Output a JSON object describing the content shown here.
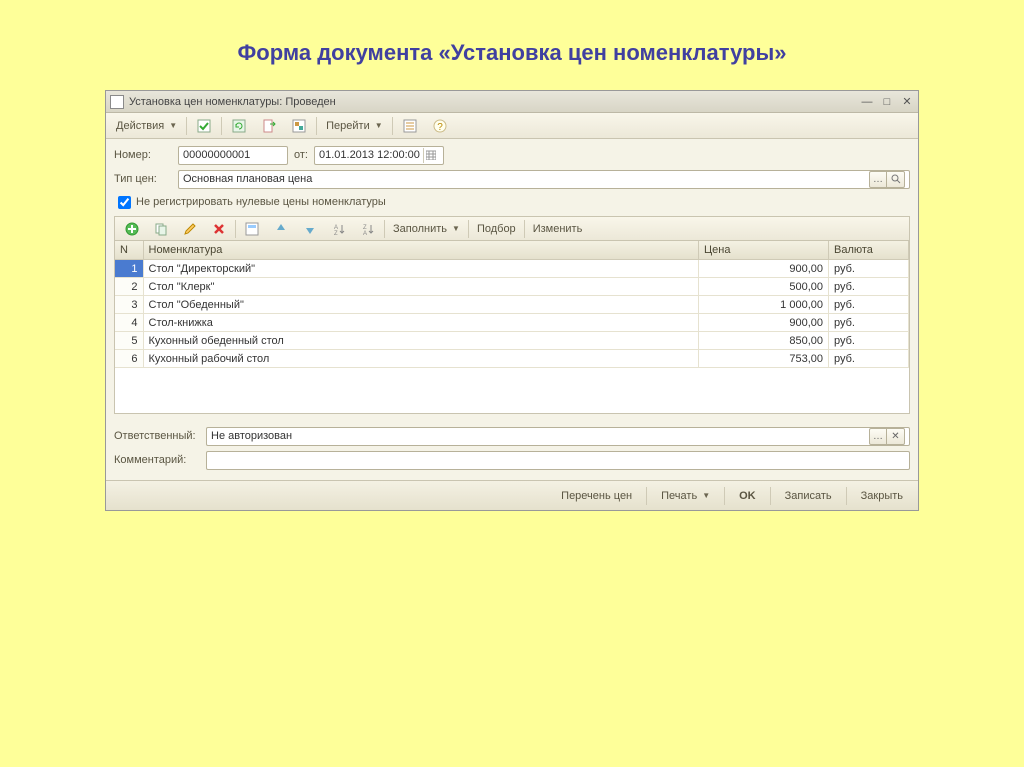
{
  "slide_title": "Форма документа «Установка цен номенклатуры»",
  "window": {
    "title": "Установка цен номенклатуры: Проведен"
  },
  "toolbar": {
    "actions": "Действия",
    "goto": "Перейти"
  },
  "fields": {
    "number_label": "Номер:",
    "number_value": "00000000001",
    "from_label": "от:",
    "date_value": "01.01.2013 12:00:00",
    "pricetype_label": "Тип цен:",
    "pricetype_value": "Основная плановая цена",
    "checkbox_label": "Не регистрировать нулевые цены номенклатуры",
    "responsible_label": "Ответственный:",
    "responsible_value": "Не авторизован",
    "comment_label": "Комментарий:"
  },
  "table_toolbar": {
    "fill": "Заполнить",
    "select": "Подбор",
    "change": "Изменить"
  },
  "table": {
    "headers": {
      "n": "N",
      "nom": "Номенклатура",
      "price": "Цена",
      "curr": "Валюта"
    },
    "rows": [
      {
        "n": "1",
        "nom": "Стол \"Директорский\"",
        "price": "900,00",
        "curr": "руб."
      },
      {
        "n": "2",
        "nom": "Стол \"Клерк\"",
        "price": "500,00",
        "curr": "руб."
      },
      {
        "n": "3",
        "nom": "Стол \"Обеденный\"",
        "price": "1 000,00",
        "curr": "руб."
      },
      {
        "n": "4",
        "nom": "Стол-книжка",
        "price": "900,00",
        "curr": "руб."
      },
      {
        "n": "5",
        "nom": "Кухонный обеденный стол",
        "price": "850,00",
        "curr": "руб."
      },
      {
        "n": "6",
        "nom": "Кухонный рабочий стол",
        "price": "753,00",
        "curr": "руб."
      }
    ]
  },
  "footer": {
    "pricelist": "Перечень цен",
    "print": "Печать",
    "ok": "OK",
    "save": "Записать",
    "close": "Закрыть"
  }
}
